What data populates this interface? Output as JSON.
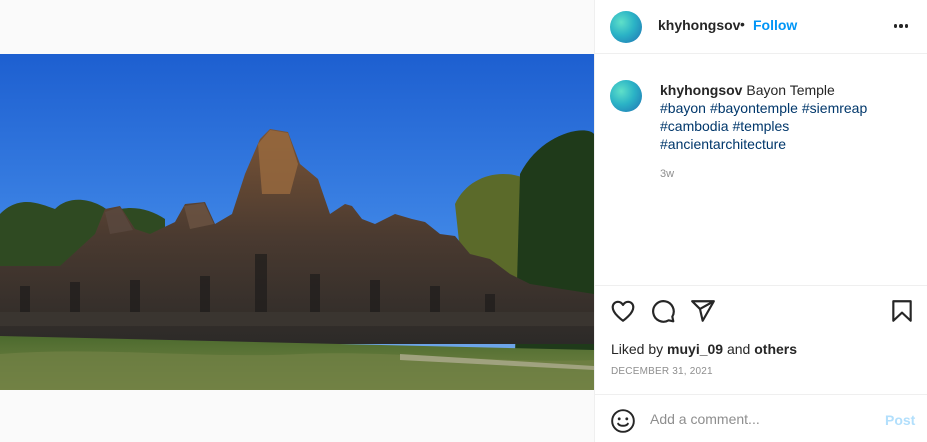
{
  "post": {
    "username": "khyhongsov",
    "separator": "•",
    "follow_label": "Follow",
    "more_icon": "more-options-icon",
    "caption_text": "Bayon Temple",
    "hashtags": [
      "#bayon",
      "#bayontemple",
      "#siemreap",
      "#cambodia",
      "#temples",
      "#ancientarchitecture"
    ],
    "age": "3w",
    "likes_prefix": "Liked by",
    "liked_by_user": "muyi_09",
    "likes_and": "and",
    "likes_others": "others",
    "date": "DECEMBER 31, 2021",
    "comment_placeholder": "Add a comment...",
    "post_label": "Post"
  },
  "icons": {
    "like": "heart-icon",
    "comment": "comment-icon",
    "share": "share-icon",
    "save": "bookmark-icon",
    "emoji": "emoji-icon"
  },
  "colors": {
    "accent": "#0095f6",
    "hashtag": "#00376b",
    "muted": "#8e8e8e",
    "post_disabled": "#b2dffc"
  }
}
